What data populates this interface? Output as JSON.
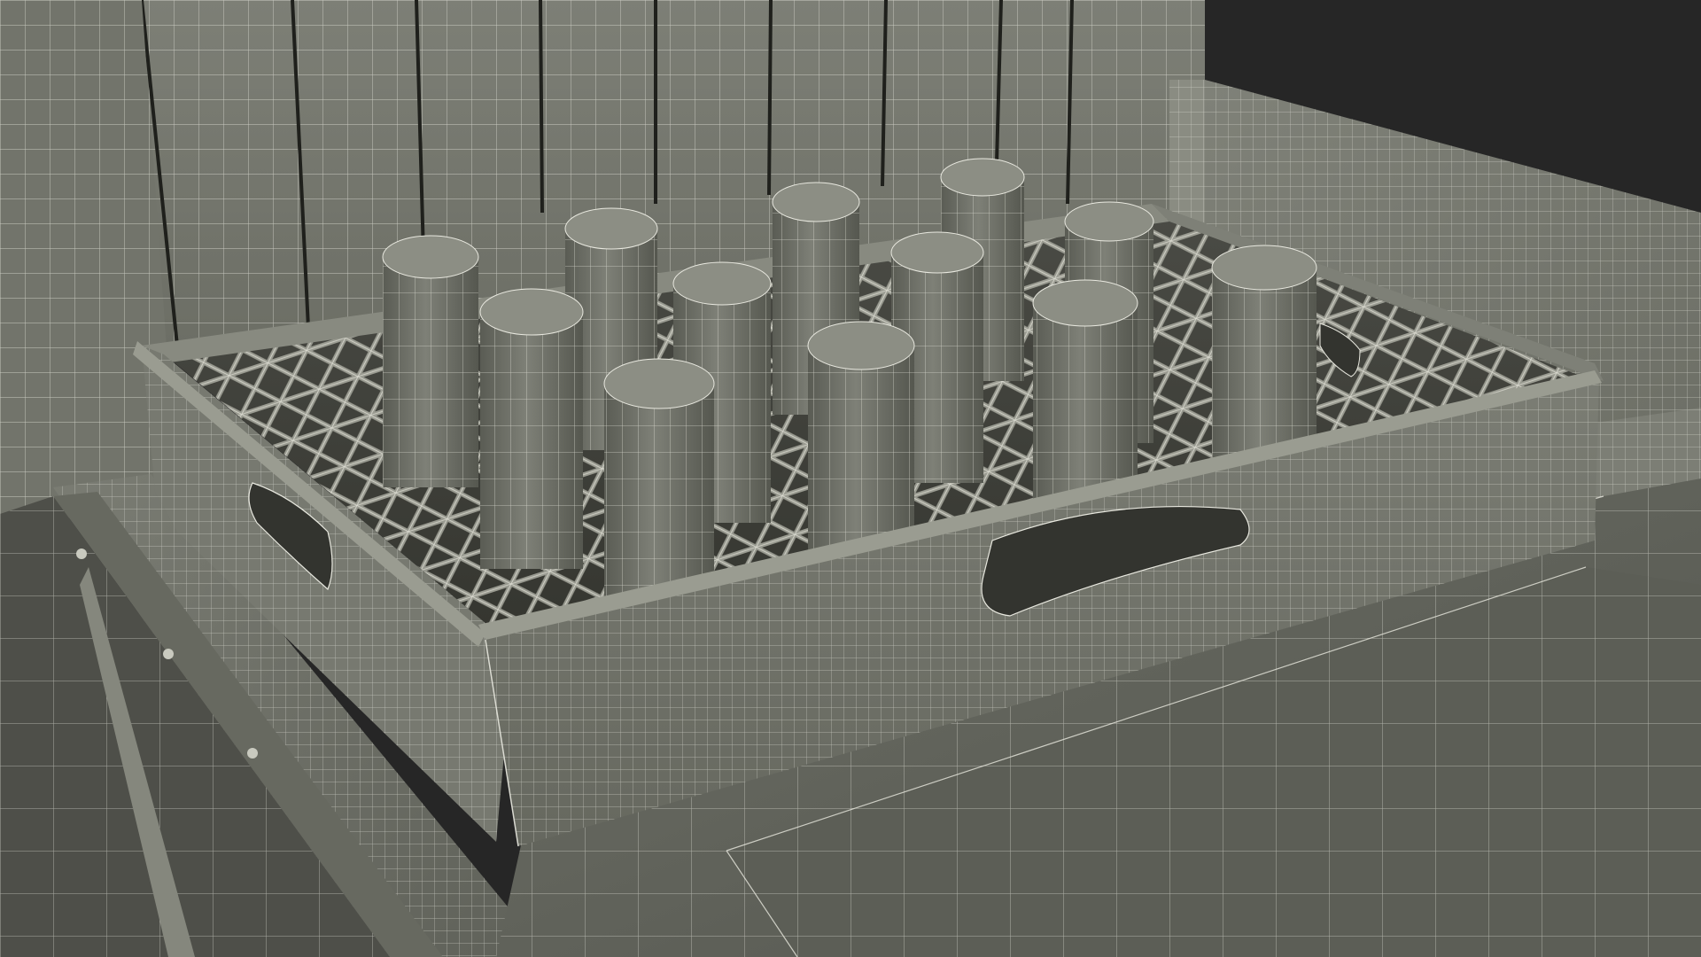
{
  "scene": {
    "subject": "wireframe-render",
    "colors": {
      "backdrop": "#262626",
      "surface_light": "#84867c",
      "surface_mid": "#6f7168",
      "surface_dark": "#55564f",
      "surface_deep": "#3b3c37",
      "wire": "#e8e8df"
    },
    "glass_count": 12,
    "elements": [
      "back-panel-planks",
      "side-wall-right",
      "counter-ledge",
      "dish-rack",
      "glasses",
      "sink-basin",
      "table-frame"
    ]
  }
}
